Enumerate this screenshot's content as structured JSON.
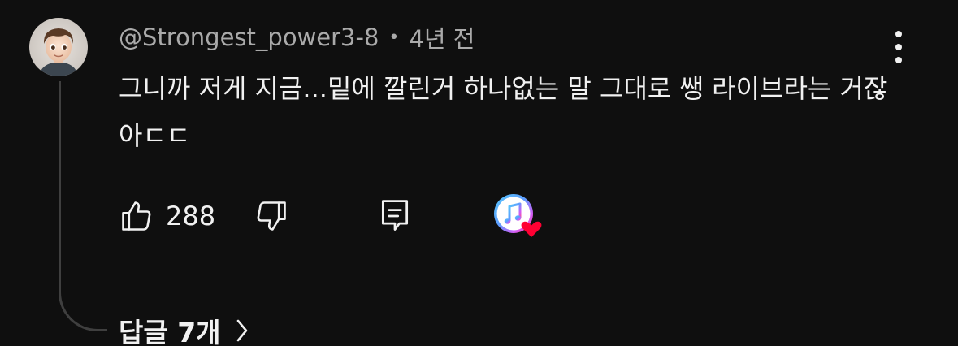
{
  "comment": {
    "author": "@Strongest_power3-8",
    "separator": "•",
    "timestamp": "4년 전",
    "text": "그니까 저게 지금...밑에 깔린거 하나없는 말 그대로 쌩 라이브라는 거잖아ㄷㄷ",
    "like_count": "288",
    "replies_label": "답글 7개"
  },
  "icons": {
    "avatar": "avatar-3d-boy",
    "like": "thumbs-up-icon",
    "dislike": "thumbs-down-icon",
    "reply": "reply-comment-icon",
    "creator_heart": "music-heart-icon",
    "menu": "kebab-menu-icon",
    "expand": "chevron-right-icon"
  },
  "colors": {
    "background": "#0f0f0f",
    "text_primary": "#f1f1f1",
    "text_secondary": "#aaaaaa",
    "heart": "#ff0033",
    "thread_line": "#3f3f3f"
  }
}
